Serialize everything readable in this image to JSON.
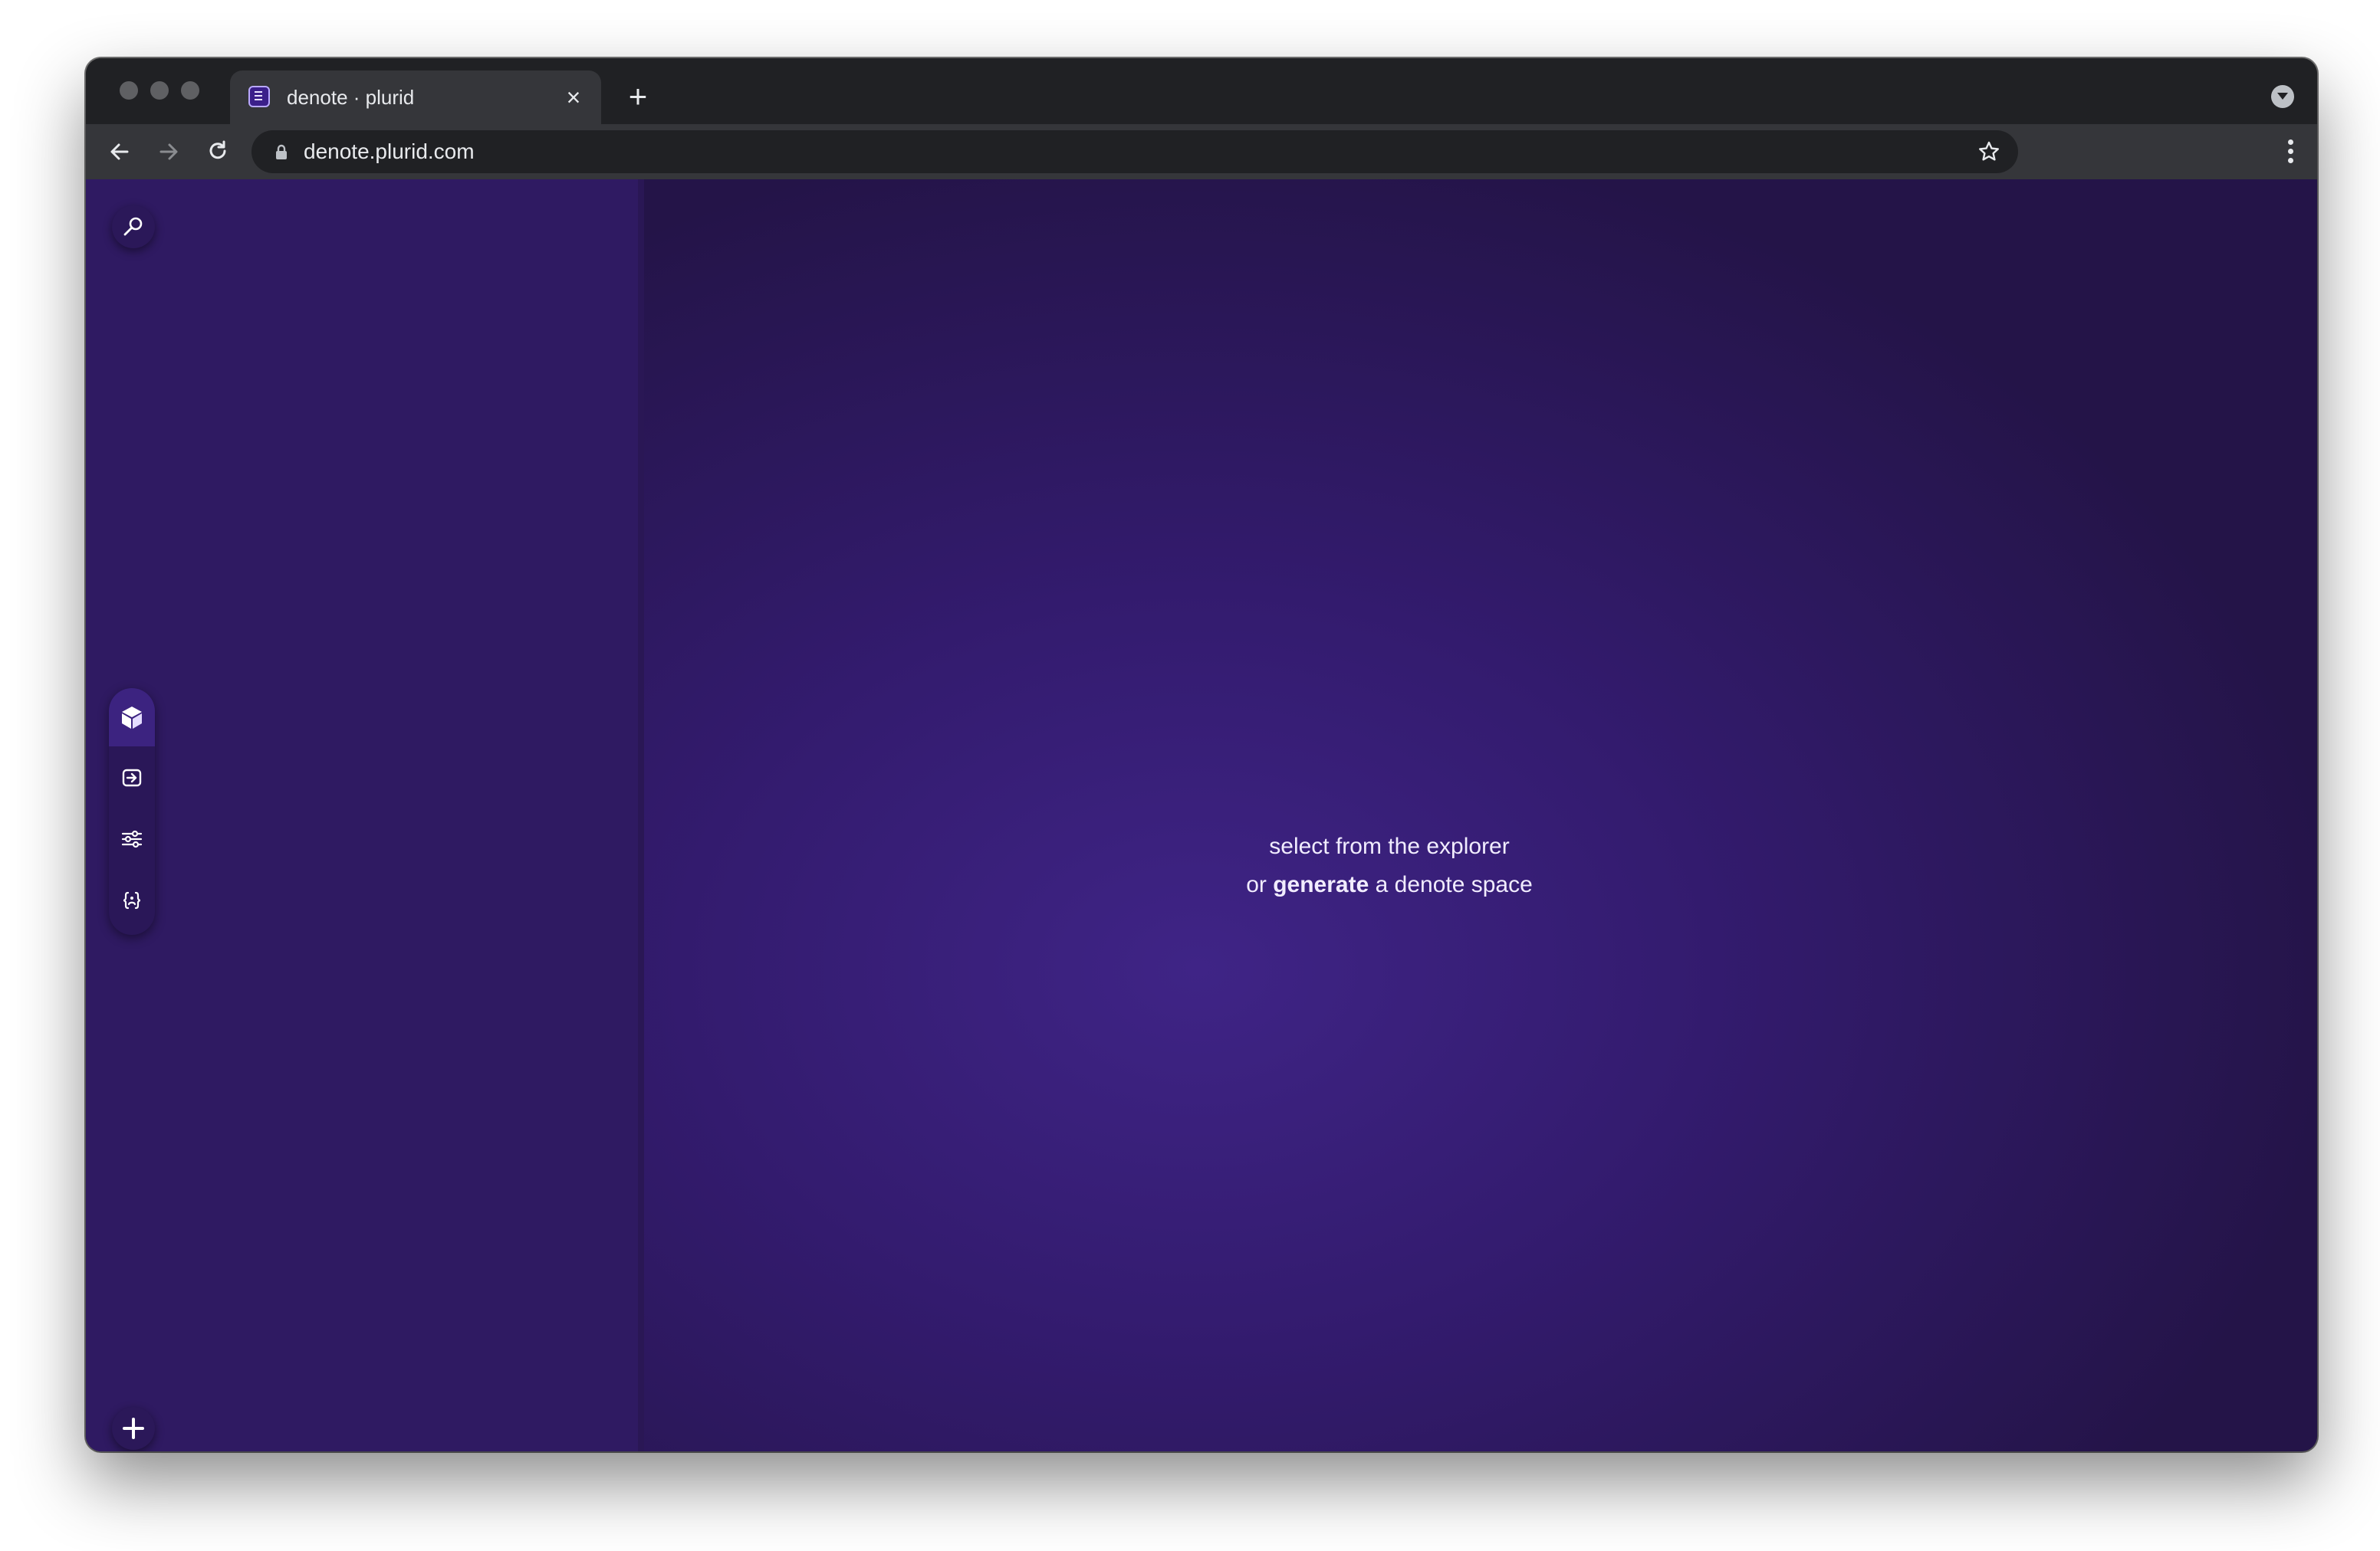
{
  "browser": {
    "tab": {
      "title": "denote · plurid",
      "close_glyph": "×",
      "favicon": "denote-favicon-icon"
    },
    "new_tab_glyph": "+",
    "address_bar": {
      "url": "denote.plurid.com",
      "secure_icon": "lock-icon"
    },
    "nav": {
      "back": "arrow-left-icon",
      "forward": "arrow-right-icon",
      "reload": "reload-icon",
      "bookmark": "star-icon",
      "menu": "more-vertical-icon",
      "tab_search": "chevron-down-circle-icon"
    }
  },
  "app": {
    "sidebar": {
      "search_icon": "search-icon",
      "rail_items": [
        {
          "icon": "cube-icon",
          "active": true
        },
        {
          "icon": "login-icon",
          "active": false
        },
        {
          "icon": "sliders-icon",
          "active": false
        },
        {
          "icon": "code-braces-icon",
          "active": false
        }
      ],
      "add_icon": "plus-icon"
    },
    "empty_state": {
      "line1": "select from the explorer",
      "line2_prefix": "or",
      "line2_action": "generate",
      "line2_suffix": "a denote space"
    },
    "colors": {
      "background": "#331b6e",
      "sidebar": "#2f1a62",
      "text": "#f1ecff",
      "chrome_dark": "#202124",
      "chrome_toolbar": "#35363a"
    }
  }
}
